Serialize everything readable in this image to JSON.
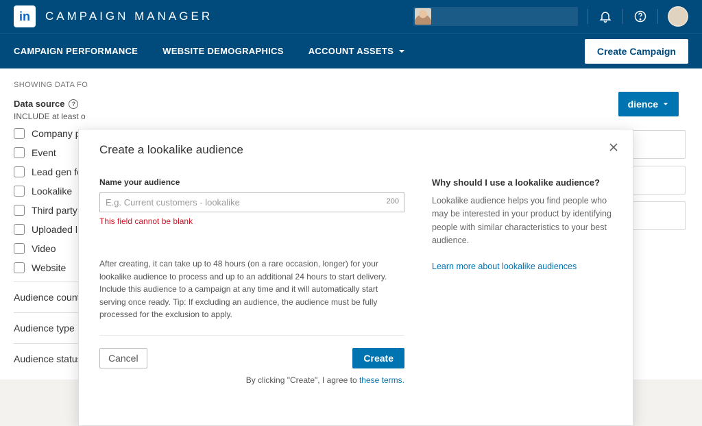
{
  "header": {
    "app_title": "CAMPAIGN MANAGER",
    "logo_text": "in"
  },
  "nav": {
    "items": [
      "CAMPAIGN PERFORMANCE",
      "WEBSITE DEMOGRAPHICS",
      "ACCOUNT ASSETS"
    ],
    "cta": "Create Campaign"
  },
  "filters": {
    "showing": "SHOWING DATA FO",
    "source_label": "Data source",
    "include_hint": "INCLUDE at least o",
    "checkboxes": [
      "Company p",
      "Event",
      "Lead gen fo",
      "Lookalike",
      "Third party",
      "Uploaded l",
      "Video",
      "Website"
    ],
    "facets": [
      "Audience count",
      "Audience type",
      "Audience status"
    ]
  },
  "right_btn": "dience",
  "modal": {
    "title": "Create a lookalike audience",
    "field_label": "Name your audience",
    "placeholder": "E.g. Current customers - lookalike",
    "char_limit": "200",
    "error": "This field cannot be blank",
    "note": "After creating, it can take up to 48 hours (on a rare occasion, longer) for your lookalike audience to process and up to an additional 24 hours to start delivery. Include this audience to a campaign at any time and it will automatically start serving once ready. Tip: If excluding an audience, the audience must be fully processed for the exclusion to apply.",
    "cancel": "Cancel",
    "create": "Create",
    "terms_prefix": "By clicking \"Create\", I agree to ",
    "terms_link": "these terms.",
    "side_title": "Why should I use a lookalike audience?",
    "side_text": "Lookalike audience helps you find people who may be interested in your product by identifying people with similar characteristics to your best audience.",
    "side_link": "Learn more about lookalike audiences"
  }
}
